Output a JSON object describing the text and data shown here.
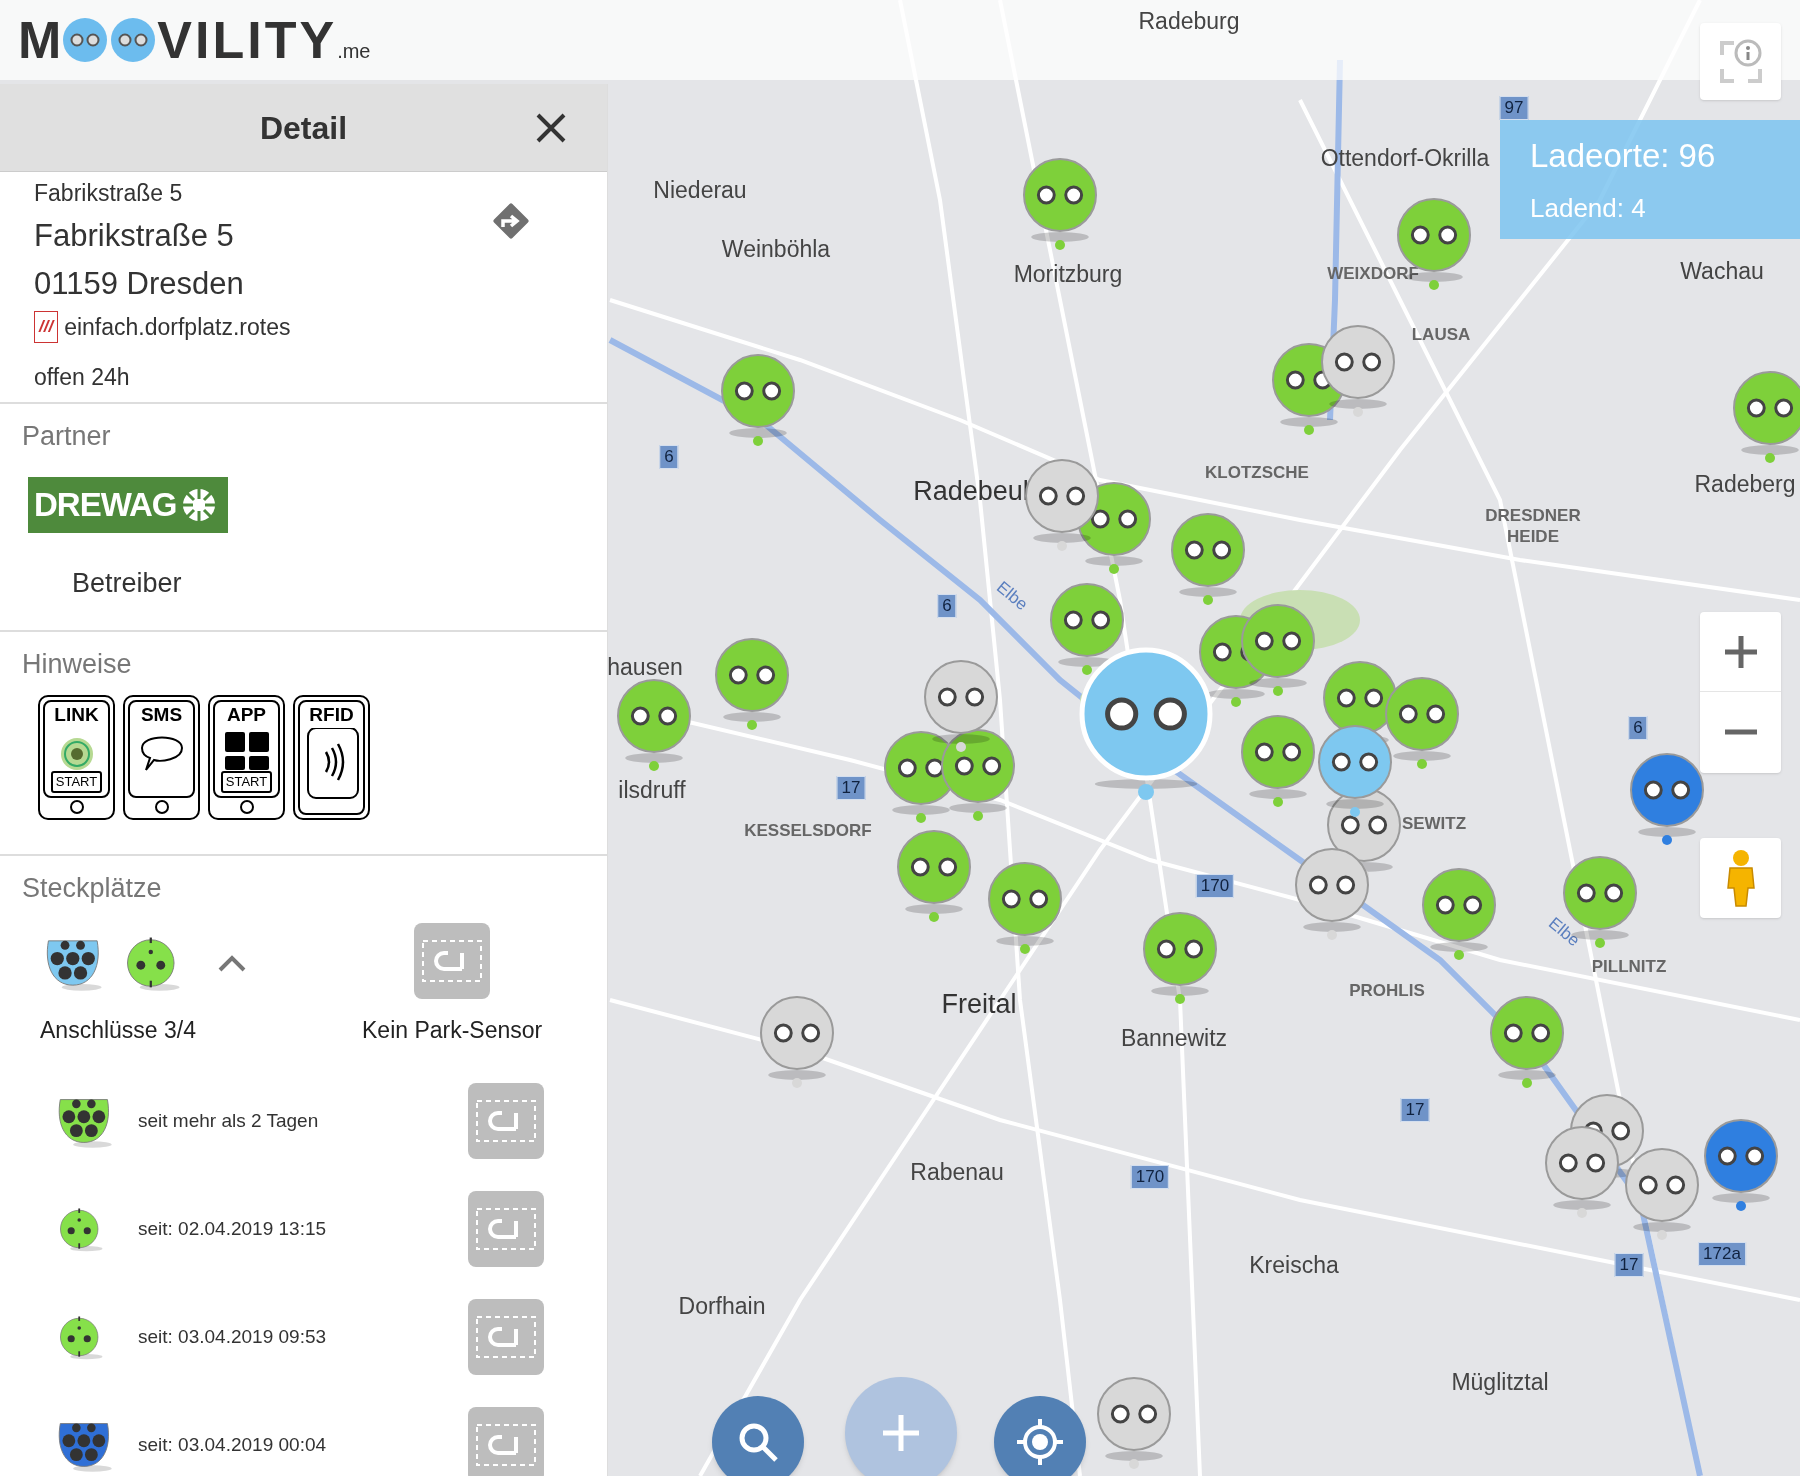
{
  "logo": {
    "parts": [
      "M",
      "VILITY"
    ],
    "suffix": ".me"
  },
  "panel": {
    "title": "Detail",
    "address": {
      "heading": "Fabrikstraße 5",
      "street": "Fabrikstraße 5",
      "city": "01159 Dresden",
      "code_mark": "///",
      "code": "einfach.dorfplatz.rotes",
      "hours": "offen 24h"
    },
    "partner": {
      "title": "Partner",
      "logo_text": "DREWAG",
      "role": "Betreiber"
    },
    "hints": {
      "title": "Hinweise",
      "items": [
        {
          "kind": "link",
          "label": "LINK",
          "button": "START"
        },
        {
          "kind": "sms",
          "label": "SMS"
        },
        {
          "kind": "app",
          "label": "APP",
          "button": "START"
        },
        {
          "kind": "rfid",
          "label": "RFID"
        }
      ]
    },
    "connectors": {
      "title": "Steckplätze",
      "expanded": true,
      "types": [
        {
          "kind": "type2",
          "color": "#7ec8f0"
        },
        {
          "kind": "schuko",
          "color": "#86e04a"
        }
      ],
      "summary": "Anschlüsse 3/4",
      "parking_label": "Kein Park-Sensor",
      "rows": [
        {
          "kind": "type2",
          "color": "#86e04a",
          "text": "seit mehr als 2 Tagen"
        },
        {
          "kind": "schuko",
          "color": "#86e04a",
          "text": "seit: 02.04.2019 13:15"
        },
        {
          "kind": "schuko",
          "color": "#86e04a",
          "text": "seit: 03.04.2019 09:53"
        },
        {
          "kind": "type2",
          "color": "#2f6fd6",
          "text": "seit: 03.04.2019 00:04"
        }
      ]
    }
  },
  "map": {
    "places": [
      {
        "kind": "town",
        "text": "Radeburg"
      },
      {
        "kind": "town",
        "text": "Niederau"
      },
      {
        "kind": "town",
        "text": "Weinböhla"
      },
      {
        "kind": "town",
        "text": "Moritzburg"
      },
      {
        "kind": "town",
        "text": "Ottendorf-Okrilla"
      },
      {
        "kind": "district",
        "text": "WEIXDORF"
      },
      {
        "kind": "town",
        "text": "Wachau"
      },
      {
        "kind": "district",
        "text": "LAUSA"
      },
      {
        "kind": "district",
        "text": "KLOTZSCHE"
      },
      {
        "kind": "city",
        "text": "Radebeul"
      },
      {
        "kind": "district",
        "text": "DRESDNER HEIDE"
      },
      {
        "kind": "town",
        "text": "Radeberg"
      },
      {
        "kind": "town",
        "text": "hausen"
      },
      {
        "kind": "town",
        "text": "ilsdruff"
      },
      {
        "kind": "district",
        "text": "KESSELSDORF"
      },
      {
        "kind": "district",
        "text": "SEWITZ"
      },
      {
        "kind": "city",
        "text": "Freital"
      },
      {
        "kind": "town",
        "text": "Bannewitz"
      },
      {
        "kind": "district",
        "text": "PROHLIS"
      },
      {
        "kind": "district",
        "text": "PILLNITZ"
      },
      {
        "kind": "town",
        "text": "Rabenau"
      },
      {
        "kind": "town",
        "text": "Kreischa"
      },
      {
        "kind": "town",
        "text": "Dorfhain"
      },
      {
        "kind": "town",
        "text": "Müglitztal"
      },
      {
        "kind": "river",
        "text": "Elbe"
      },
      {
        "kind": "river",
        "text": "Elbe"
      }
    ],
    "roads": [
      "97",
      "6",
      "6",
      "17",
      "170",
      "170",
      "17",
      "17",
      "172a",
      "6"
    ],
    "markers": [
      {
        "color": "#7ed03a",
        "selected": false
      },
      {
        "color": "#7ed03a",
        "selected": false
      },
      {
        "color": "#7ed03a",
        "selected": false
      },
      {
        "color": "#7ed03a",
        "selected": false
      },
      {
        "color": "#7ed03a",
        "selected": false
      },
      {
        "color": "#7ed03a",
        "selected": false
      },
      {
        "color": "#7ed03a",
        "selected": false
      },
      {
        "color": "#7ed03a",
        "selected": false
      },
      {
        "color": "#7ed03a",
        "selected": false
      },
      {
        "color": "#7ed03a",
        "selected": false
      },
      {
        "color": "#7ed03a",
        "selected": false
      },
      {
        "color": "#7ed03a",
        "selected": false
      },
      {
        "color": "#7ed03a",
        "selected": false
      },
      {
        "color": "#7ed03a",
        "selected": false
      },
      {
        "color": "#7ed03a",
        "selected": false
      },
      {
        "color": "#7ed03a",
        "selected": false
      },
      {
        "color": "#7ed03a",
        "selected": false
      },
      {
        "color": "#7ed03a",
        "selected": false
      },
      {
        "color": "#7ed03a",
        "selected": false
      },
      {
        "color": "#7ed03a",
        "selected": false
      },
      {
        "color": "#7ed03a",
        "selected": false
      },
      {
        "color": "#7ed03a",
        "selected": false
      },
      {
        "color": "#7ed03a",
        "selected": false
      },
      {
        "color": "#d8d8d8",
        "selected": false
      },
      {
        "color": "#d8d8d8",
        "selected": false
      },
      {
        "color": "#d8d8d8",
        "selected": false
      },
      {
        "color": "#d8d8d8",
        "selected": false
      },
      {
        "color": "#d8d8d8",
        "selected": false
      },
      {
        "color": "#d8d8d8",
        "selected": false
      },
      {
        "color": "#d8d8d8",
        "selected": false
      },
      {
        "color": "#d8d8d8",
        "selected": false
      },
      {
        "color": "#d8d8d8",
        "selected": false
      },
      {
        "color": "#d8d8d8",
        "selected": false
      },
      {
        "color": "#7ec8f0",
        "selected": false
      },
      {
        "color": "#2f7fe0",
        "selected": false
      },
      {
        "color": "#2f7fe0",
        "selected": false
      },
      {
        "color": "#7ec8f0",
        "selected": true
      }
    ],
    "stats": {
      "locations": "Ladeorte: 96",
      "charging": "Ladend: 4"
    }
  }
}
